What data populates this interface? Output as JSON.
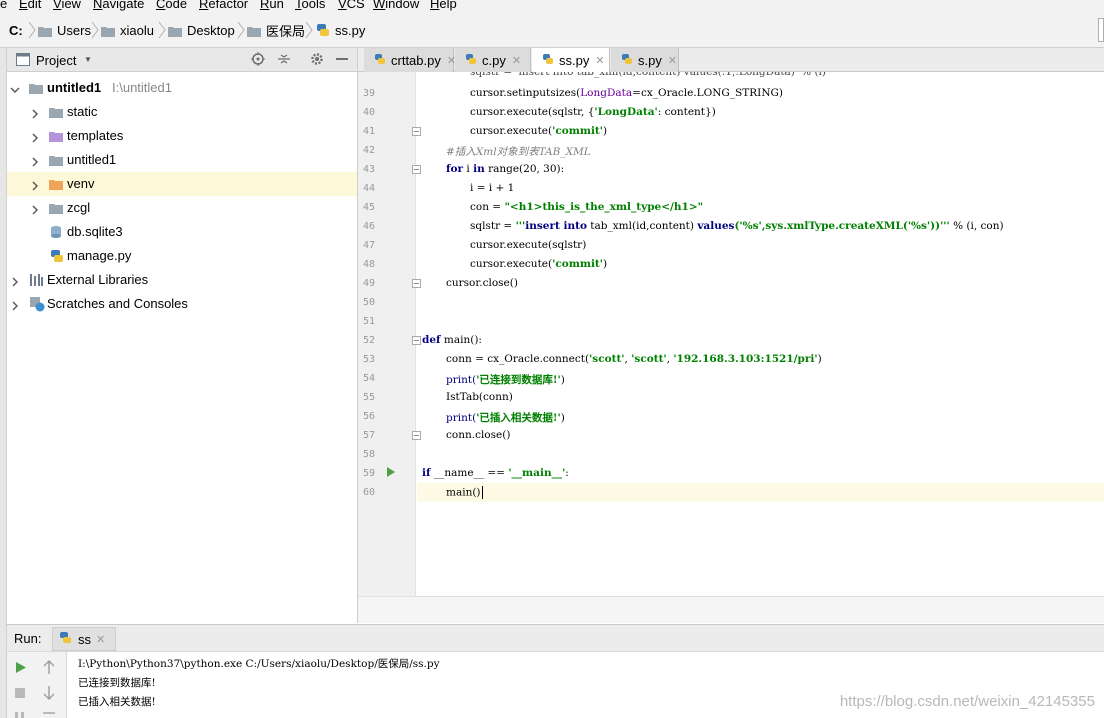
{
  "menu": {
    "items": [
      "e",
      "Edit",
      "View",
      "Navigate",
      "Code",
      "Refactor",
      "Run",
      "Tools",
      "VCS",
      "Window",
      "Help"
    ]
  },
  "breadcrumb": {
    "items": [
      "C:",
      "Users",
      "xiaolu",
      "Desktop",
      "医保局",
      "ss.py"
    ]
  },
  "project": {
    "title": "Project",
    "root_name": "untitled1",
    "root_path": "I:\\untitled1",
    "children": [
      "static",
      "templates",
      "untitled1",
      "venv",
      "zcgl",
      "db.sqlite3",
      "manage.py"
    ],
    "external_libraries": "External Libraries",
    "scratches": "Scratches and Consoles"
  },
  "editor": {
    "tabs": [
      "crttab.py",
      "c.py",
      "ss.py",
      "s.py"
    ],
    "active_tab": "ss.py",
    "line_numbers": [
      "39",
      "40",
      "41",
      "42",
      "43",
      "44",
      "45",
      "46",
      "47",
      "48",
      "49",
      "50",
      "51",
      "52",
      "53",
      "54",
      "55",
      "56",
      "57",
      "58",
      "59",
      "60"
    ],
    "code": {
      "l39_a": "cursor.setinputsizes(",
      "l39_b": "LongData",
      "l39_c": "=cx_Oracle.LONG_STRING)",
      "l40_a": "cursor.execute(sqlstr, {",
      "l40_b": "'LongData'",
      "l40_c": ": content})",
      "l41_a": "cursor.execute(",
      "l41_b": "'commit'",
      "l41_c": ")",
      "l42": "#插入Xml对象到表TAB_XML",
      "l43_a": "for",
      "l43_b": " i ",
      "l43_c": "in",
      "l43_d": " range(20, 30):",
      "l44": "i = i + 1",
      "l45_a": "con = ",
      "l45_b": "\"<h1>this_is_the_xml_type</h1>\"",
      "l46_a": "sqlstr = ",
      "l46_b": "'''",
      "l46_c": "insert into",
      "l46_d": " tab_xml(id,content) ",
      "l46_e": "values",
      "l46_f": "('%s',sys.xmlType.createXML('%s'))'''",
      "l46_g": " % (i, con)",
      "l47": "cursor.execute(sqlstr)",
      "l48_a": "cursor.execute(",
      "l48_b": "'commit'",
      "l48_c": ")",
      "l49": "cursor.close()",
      "l52_a": "def",
      "l52_b": " main():",
      "l53_a": "conn = cx_Oracle.connect(",
      "l53_b": "'scott'",
      "l53_c": ", ",
      "l53_d": "'scott'",
      "l53_e": ", ",
      "l53_f": "'192.168.3.103:1521/pri'",
      "l53_g": ")",
      "l54_a": "print(",
      "l54_b": "'已连接到数据库!'",
      "l54_c": ")",
      "l55": "IstTab(conn)",
      "l56_a": "print(",
      "l56_b": "'已插入相关数据!'",
      "l56_c": ")",
      "l57": "conn.close()",
      "l59_a": "if",
      "l59_b": " __name__ == ",
      "l59_c": "'__main__'",
      "l59_d": ":",
      "l60": "main()"
    }
  },
  "run": {
    "label": "Run:",
    "tab": "ss",
    "output": [
      "I:\\Python\\Python37\\python.exe C:/Users/xiaolu/Desktop/医保局/ss.py",
      "已连接到数据库!",
      "已插入相关数据!"
    ]
  },
  "watermark": "https://blog.csdn.net/weixin_42145355"
}
